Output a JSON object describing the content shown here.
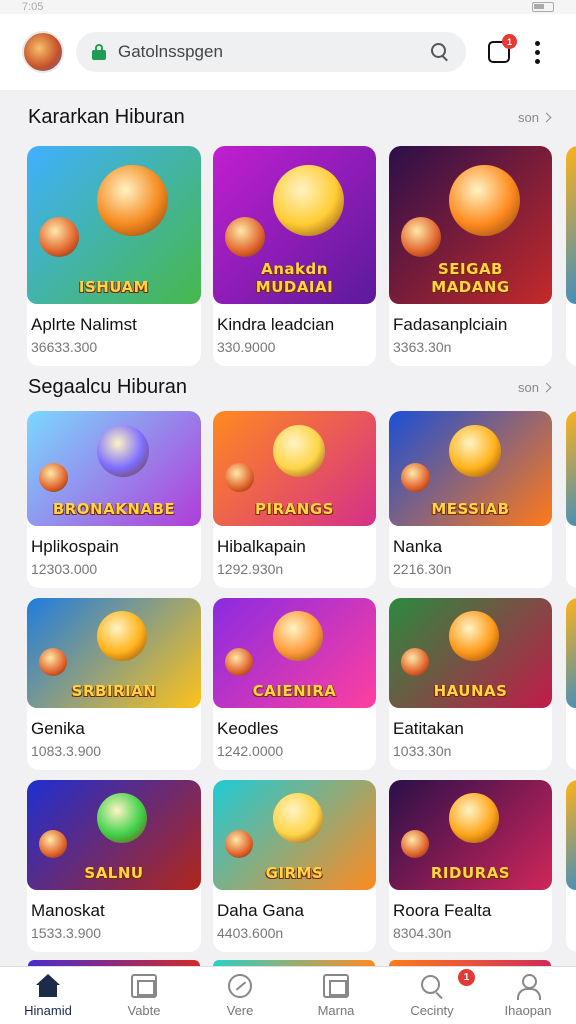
{
  "status": {
    "time": "7:05"
  },
  "browser": {
    "url": "Gatolnsspgen",
    "tab_count": "",
    "tab_badge": "1"
  },
  "sections": [
    {
      "title": "Kararkan Hiburan",
      "more_label": "son"
    },
    {
      "title": "Segaalcu Hiburan",
      "more_label": "son"
    }
  ],
  "rows": [
    [
      {
        "name": "Aplrte Nalimst",
        "count": "36633.300",
        "art": "ISHUAM",
        "bg": [
          "#3fb0ff",
          "#47b84a"
        ],
        "accent": "#f58a1f"
      },
      {
        "name": "Kindra leadcian",
        "count": "330.9000",
        "art": "Anakdn MUDAIAI",
        "bg": [
          "#c21fd1",
          "#5b1a9c"
        ],
        "accent": "#ffcc33"
      },
      {
        "name": "Fadasanplciain",
        "count": "3363.30n",
        "art": "SEIGAB MADANG",
        "bg": [
          "#2b0f4a",
          "#c42a2a"
        ],
        "accent": "#ff8a1f"
      }
    ],
    [
      {
        "name": "Hplikospain",
        "count": "12303.000",
        "art": "BRONAKNABE",
        "bg": [
          "#7ad8ff",
          "#b13cd9"
        ],
        "accent": "#7b6cff"
      },
      {
        "name": "Hibalkapain",
        "count": "1292.930n",
        "art": "PIRANGS",
        "bg": [
          "#ff8a1f",
          "#d62f8a"
        ],
        "accent": "#ffd447"
      },
      {
        "name": "Nanka",
        "count": "2216.30n",
        "art": "MESSIAB",
        "bg": [
          "#1b4fd6",
          "#ff7a1a"
        ],
        "accent": "#ffb21a"
      }
    ],
    [
      {
        "name": "Genika",
        "count": "1083.3.900",
        "art": "SRBIRIAN",
        "bg": [
          "#1f7ce0",
          "#ffc21a"
        ],
        "accent": "#ffb21a"
      },
      {
        "name": "Keodles",
        "count": "1242.0000",
        "art": "CAIENIRA",
        "bg": [
          "#8a2be2",
          "#ff3fa0"
        ],
        "accent": "#ff9a3a"
      },
      {
        "name": "Eatitakan",
        "count": "1033.30n",
        "art": "HAUNAS",
        "bg": [
          "#2b8a3e",
          "#c21a4a"
        ],
        "accent": "#ff9a1a"
      }
    ],
    [
      {
        "name": "Manoskat",
        "count": "1533.3.900",
        "art": "SALNU",
        "bg": [
          "#1e2fd1",
          "#b1261a"
        ],
        "accent": "#3fd24a"
      },
      {
        "name": "Daha Gana",
        "count": "4403.600n",
        "art": "GIRMS",
        "bg": [
          "#1ecbd6",
          "#ff8a1f"
        ],
        "accent": "#ffd447"
      },
      {
        "name": "Roora Fealta",
        "count": "8304.30n",
        "art": "RIDURAS",
        "bg": [
          "#2a0f4a",
          "#d1265a"
        ],
        "accent": "#ffa51a"
      }
    ]
  ],
  "nav": [
    {
      "label": "Hinamid",
      "icon": "home-icon"
    },
    {
      "label": "Vabte",
      "icon": "inbox-icon"
    },
    {
      "label": "Vere",
      "icon": "compass-icon"
    },
    {
      "label": "Marna",
      "icon": "mail-icon"
    },
    {
      "label": "Cecinty",
      "icon": "search-icon",
      "badge": "1"
    },
    {
      "label": "Ihaopan",
      "icon": "user-icon"
    }
  ]
}
